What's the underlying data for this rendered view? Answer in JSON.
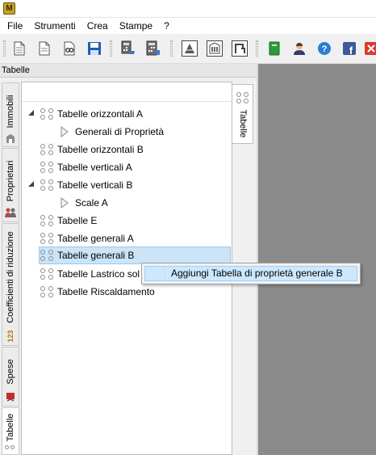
{
  "app": {
    "icon_letter": "M"
  },
  "menubar": {
    "items": [
      "File",
      "Strumenti",
      "Crea",
      "Stampe",
      "?"
    ]
  },
  "toolbar": {
    "buttons": [
      "new-document-icon",
      "open-document-icon",
      "print-preview-icon",
      "save-icon",
      "calculator-cart-icon",
      "calculator-icon",
      "pyramid-icon",
      "building-icon",
      "pipe-icon",
      "green-book-icon",
      "user-icon",
      "help-icon",
      "facebook-icon",
      "close-icon"
    ]
  },
  "panel": {
    "title": "Tabelle"
  },
  "left_tabs": [
    {
      "label": "Immobili",
      "icon": "building-icon"
    },
    {
      "label": "Proprietari",
      "icon": "people-icon"
    },
    {
      "label": "Coefficienti di riduzione",
      "icon": "numbers-icon",
      "icon_text": "123"
    },
    {
      "label": "Spese",
      "icon": "expense-icon"
    },
    {
      "label": "Tabelle",
      "icon": "table-dots-icon"
    }
  ],
  "right_tab": {
    "label": "Tabelle"
  },
  "tree": {
    "items": [
      {
        "label": "Tabelle orizzontali A",
        "expanded": true
      },
      {
        "label": "Generali di Proprietà",
        "child": true
      },
      {
        "label": "Tabelle orizzontali B"
      },
      {
        "label": "Tabelle verticali A"
      },
      {
        "label": "Tabelle verticali B",
        "expanded": true
      },
      {
        "label": "Scale A",
        "child": true
      },
      {
        "label": "Tabelle E"
      },
      {
        "label": "Tabelle generali A"
      },
      {
        "label": "Tabelle generali B",
        "selected": true
      },
      {
        "label": "Tabelle Lastrico sol"
      },
      {
        "label": "Tabelle Riscaldamento"
      }
    ]
  },
  "context_menu": {
    "items": [
      "Aggiungi Tabella di proprietà generale B"
    ]
  },
  "colors": {
    "selection": "#cce4f7",
    "workspace": "#8a8a8a",
    "menu_highlight": "#cce8ff"
  }
}
